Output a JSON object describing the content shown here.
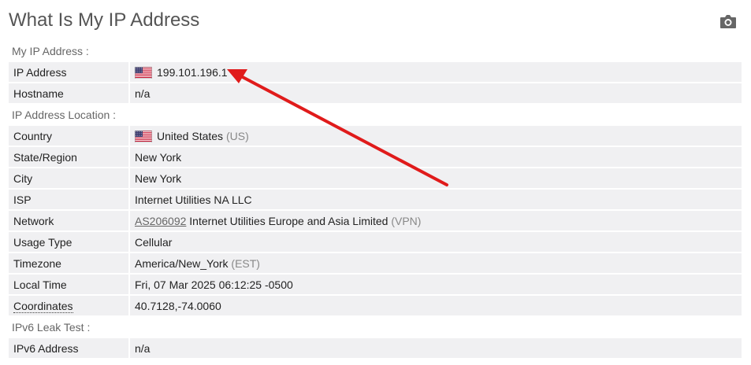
{
  "title": "What Is My IP Address",
  "icons": {
    "camera": "camera-icon",
    "flag": "us-flag-icon",
    "annotation": "red-arrow-annotation"
  },
  "colors": {
    "title": "#555555",
    "row_bg": "#f0f0f2",
    "arrow": "#e01b1b",
    "muted": "#888888"
  },
  "my_ip": {
    "section_label": "My IP Address :",
    "ip_label": "IP Address",
    "ip_value": "199.101.196.1",
    "hostname_label": "Hostname",
    "hostname_value": "n/a"
  },
  "location": {
    "section_label": "IP Address Location :",
    "country_label": "Country",
    "country_value": "United States",
    "country_code": "(US)",
    "state_label": "State/Region",
    "state_value": "New York",
    "city_label": "City",
    "city_value": "New York",
    "isp_label": "ISP",
    "isp_value": "Internet Utilities NA LLC",
    "network_label": "Network",
    "network_asn": "AS206092",
    "network_name": "Internet Utilities Europe and Asia Limited",
    "network_tag": "(VPN)",
    "usage_label": "Usage Type",
    "usage_value": "Cellular",
    "timezone_label": "Timezone",
    "timezone_value": "America/New_York",
    "timezone_abbr": "(EST)",
    "localtime_label": "Local Time",
    "localtime_value": "Fri, 07 Mar 2025 06:12:25 -0500",
    "coords_label": "Coordinates",
    "coords_value": "40.7128,-74.0060"
  },
  "ipv6": {
    "section_label": "IPv6 Leak Test :",
    "address_label": "IPv6 Address",
    "address_value": "n/a"
  }
}
